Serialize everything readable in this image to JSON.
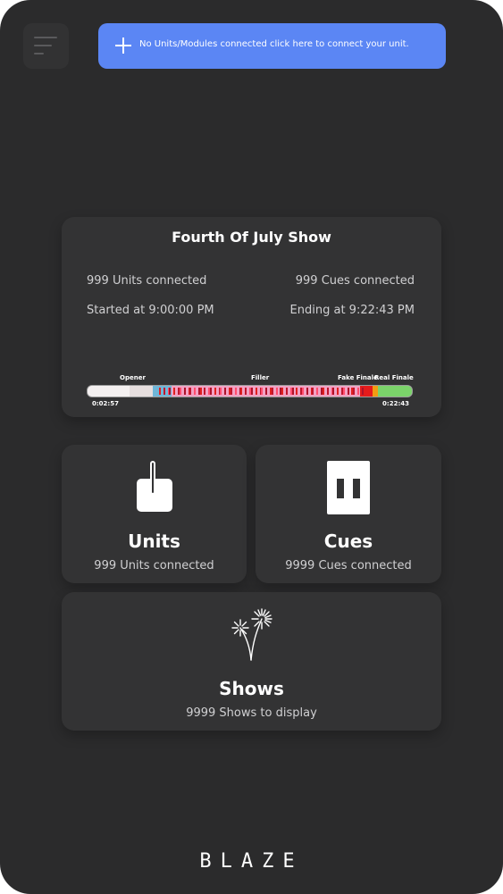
{
  "colors": {
    "device_bg": "#2b2b2c",
    "card_bg": "#333334",
    "banner_bg": "#5b86f4",
    "muted_text": "#d0d0d2"
  },
  "header": {
    "menu_icon": "hamburger-menu-icon",
    "banner_text": "No Units/Modules connected click here to connect your unit.",
    "banner_icon": "plus-icon"
  },
  "show": {
    "title": "Fourth Of July Show",
    "units_connected": "999 Units connected",
    "cues_connected": "999 Cues connected",
    "started": "Started at 9:00:00 PM",
    "ending": "Ending at 9:22:43 PM",
    "markers": [
      "Opener",
      "Filler",
      "Fake Finale",
      "Real Finale"
    ],
    "elapsed": "0:02:57",
    "total": "0:22:43",
    "progress": 0.13
  },
  "tiles": {
    "units": {
      "title": "Units",
      "subtitle": "999 Units connected",
      "icon": "unit-module-icon"
    },
    "cues": {
      "title": "Cues",
      "subtitle": "9999 Cues connected",
      "icon": "cue-panel-icon"
    },
    "shows": {
      "title": "Shows",
      "subtitle": "9999 Shows to display",
      "icon": "fireworks-icon"
    }
  },
  "brand": "BLAZE"
}
